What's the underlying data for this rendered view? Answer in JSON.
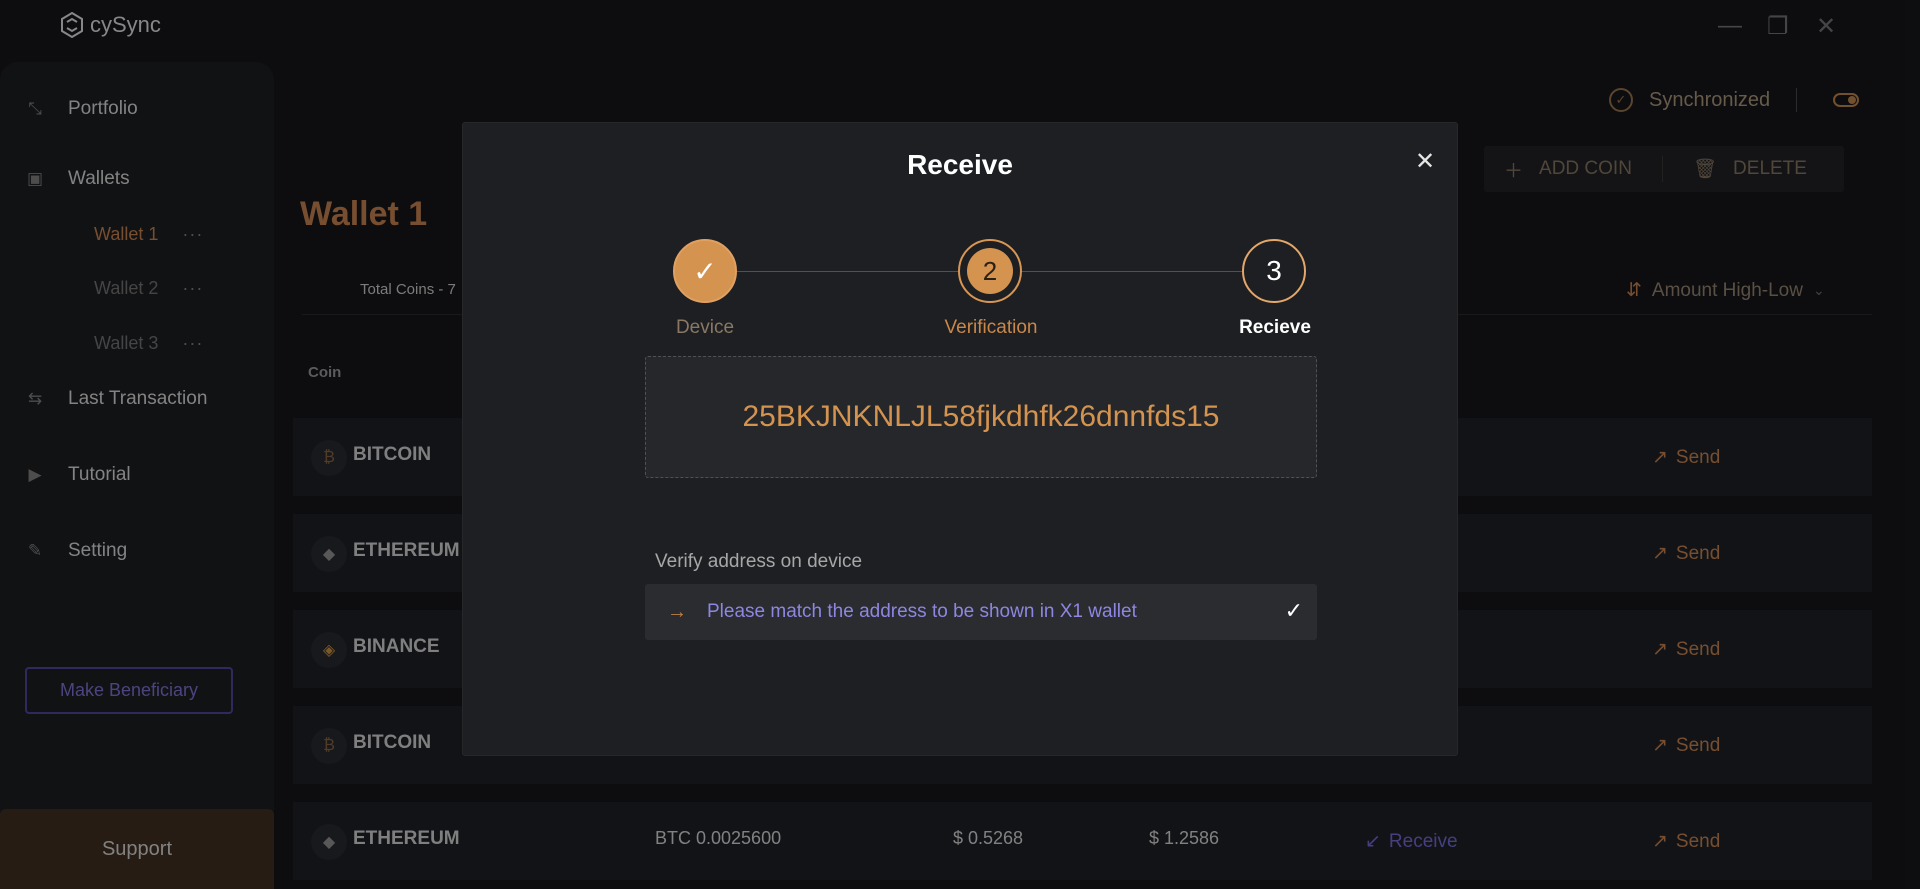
{
  "app": {
    "name": "cySync",
    "window": {
      "minimize": "—",
      "maximize": "❐",
      "close": "✕"
    }
  },
  "sidebar": {
    "items": [
      {
        "label": "Portfolio",
        "icon": "portfolio-icon"
      },
      {
        "label": "Wallets",
        "icon": "wallet-icon"
      },
      {
        "label": "Last Transaction",
        "icon": "transaction-icon"
      },
      {
        "label": "Tutorial",
        "icon": "tutorial-icon"
      },
      {
        "label": "Setting",
        "icon": "settings-icon"
      }
    ],
    "wallets": [
      {
        "label": "Wallet 1",
        "active": true,
        "more": "···"
      },
      {
        "label": "Wallet 2",
        "active": false,
        "more": "···"
      },
      {
        "label": "Wallet 3",
        "active": false,
        "more": "···"
      }
    ],
    "beneficiary": "Make Beneficiary",
    "support": "Support"
  },
  "header": {
    "sync_status": "Synchronized",
    "add_coin": "ADD COIN",
    "delete": "DELETE"
  },
  "main": {
    "wallet_title": "Wallet 1",
    "total_coins": "Total Coins - 7",
    "sort": "Amount High-Low",
    "coin_header": "Coin",
    "rows": [
      {
        "coin": "BITCOIN",
        "symbol": "₿",
        "send": "Send"
      },
      {
        "coin": "ETHEREUM",
        "symbol": "◆",
        "send": "Send"
      },
      {
        "coin": "BINANCE",
        "symbol": "◈",
        "send": "Send"
      },
      {
        "coin": "BITCOIN",
        "symbol": "₿",
        "send": "Send"
      },
      {
        "coin": "ETHEREUM",
        "symbol": "◆",
        "amount": "BTC 0.0025600",
        "value1": "$ 0.5268",
        "value2": "$ 1.2586",
        "receive": "Receive",
        "send": "Send"
      }
    ]
  },
  "modal": {
    "title": "Receive",
    "close": "✕",
    "steps": [
      {
        "label": "Device",
        "symbol": "✓",
        "state": "done"
      },
      {
        "label": "Verification",
        "symbol": "2",
        "state": "active"
      },
      {
        "label": "Recieve",
        "symbol": "3",
        "state": "pending"
      }
    ],
    "address": "25BKJNKNLJL58fjkdhfk26dnnfds15",
    "verify_label": "Verify address on device",
    "verify_text": "Please match the address to be shown in X1 wallet",
    "verify_check": "✓",
    "verify_arrow": "→"
  },
  "colors": {
    "accent": "#d4934e",
    "purple": "#8e86e0",
    "background": "#141518"
  }
}
